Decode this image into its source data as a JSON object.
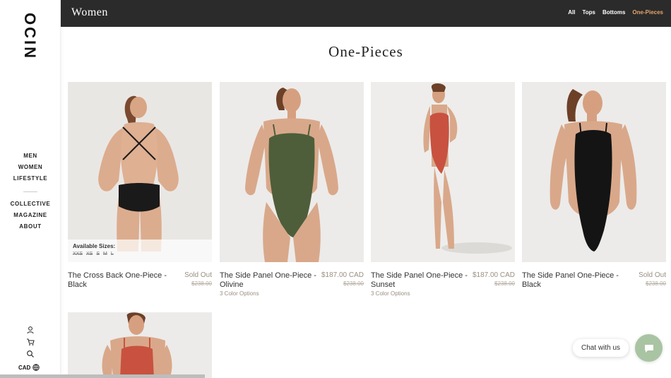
{
  "sidebar": {
    "logo": "OCIN",
    "nav_primary": [
      "MEN",
      "WOMEN",
      "LIFESTYLE"
    ],
    "nav_secondary": [
      "COLLECTIVE",
      "MAGAZINE",
      "ABOUT"
    ],
    "currency": "CAD",
    "icons": [
      "account-icon",
      "cart-icon",
      "search-icon",
      "globe-icon"
    ]
  },
  "topbar": {
    "title": "Women",
    "filters": [
      "All",
      "Tops",
      "Bottoms",
      "One-Pieces"
    ],
    "active_filter": "One-Pieces",
    "active_color": "#e4a56a"
  },
  "page_title": "One-Pieces",
  "products": [
    {
      "name": "The Cross Back One-Piece - Black",
      "price": "Sold Out",
      "original_price": "$238.00",
      "variants": "",
      "swimsuit_color": "#1a1a1a",
      "available_sizes_label": "Available Sizes:",
      "sizes": [
        "XXS",
        "XS",
        "S",
        "M",
        "L"
      ]
    },
    {
      "name": "The Side Panel One-Piece - Olivine",
      "price": "$187.00 CAD",
      "original_price": "$238.00",
      "variants": "3 Color Options",
      "swimsuit_color": "#4e5e3a"
    },
    {
      "name": "The Side Panel One-Piece - Sunset",
      "price": "$187.00 CAD",
      "original_price": "$238.00",
      "variants": "3 Color Options",
      "swimsuit_color": "#c8523f"
    },
    {
      "name": "The Side Panel One-Piece - Black",
      "price": "Sold Out",
      "original_price": "$238.00",
      "variants": "",
      "swimsuit_color": "#141414"
    },
    {
      "name": "",
      "price": "",
      "original_price": "",
      "variants": "",
      "swimsuit_color": "#c8523f"
    }
  ],
  "chat": {
    "label": "Chat with us",
    "button_color": "#a9c4a2"
  }
}
